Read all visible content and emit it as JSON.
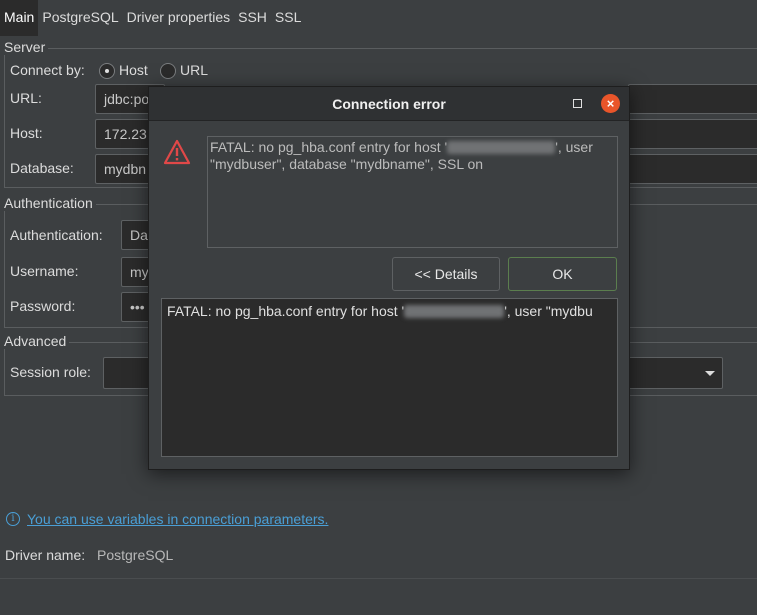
{
  "tabs": [
    "Main",
    "PostgreSQL",
    "Driver properties",
    "SSH",
    "SSL"
  ],
  "server": {
    "title": "Server",
    "connect_by_label": "Connect by:",
    "host_option": "Host",
    "url_option": "URL",
    "url_label": "URL:",
    "url_value": "jdbc:po",
    "host_label": "Host:",
    "host_value": "172.23",
    "database_label": "Database:",
    "database_value": "mydbn"
  },
  "authentication": {
    "title": "Authentication",
    "auth_label": "Authentication:",
    "auth_value": "Da",
    "username_label": "Username:",
    "username_value": "my",
    "password_label": "Password:",
    "password_value": "•••"
  },
  "advanced": {
    "title": "Advanced",
    "session_role_label": "Session role:"
  },
  "info_link": "You can use variables in connection parameters.",
  "driver": {
    "label": "Driver name:",
    "value": "PostgreSQL"
  },
  "dialog": {
    "title": "Connection error",
    "message_part1": "FATAL: no pg_hba.conf entry for host '",
    "message_part2": "', user \"mydbuser\", database \"mydbname\", SSL on",
    "details_button": "<< Details",
    "ok_button": "OK",
    "details_part1": "FATAL: no pg_hba.conf entry for host '",
    "details_part2": "', user \"mydbu"
  },
  "colors": {
    "background": "#3c3f41",
    "field": "#2b2b2b",
    "link": "#4a9fd6",
    "close": "#e9552a",
    "warning": "#e04848"
  }
}
